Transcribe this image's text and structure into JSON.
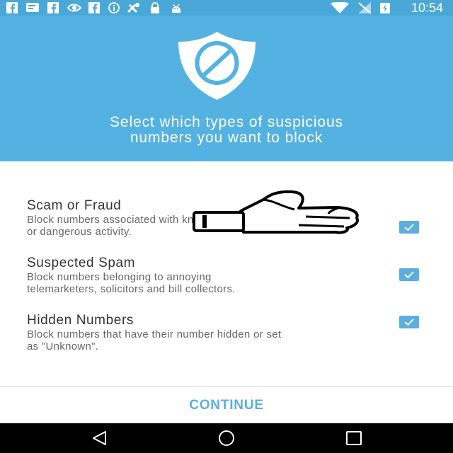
{
  "status_bar": {
    "time": "10:54",
    "icons": [
      "facebook-icon",
      "message-icon",
      "facebook-icon",
      "nvidia-icon",
      "facebook-icon",
      "info-icon",
      "tools-icon",
      "lock-icon",
      "android-icon",
      "wifi-icon",
      "no-signal-icon",
      "battery-charging-icon"
    ]
  },
  "header": {
    "icon": "shield-block-icon",
    "title_line1": "Select which types of suspicious",
    "title_line2": "numbers you want to block"
  },
  "options": [
    {
      "title": "Scam or Fraud",
      "desc_line1": "Block numbers associated with known scams, fraud",
      "desc_line2": "or dangerous activity.",
      "checked": true
    },
    {
      "title": "Suspected Spam",
      "desc_line1": "Block numbers belonging to annoying",
      "desc_line2": "telemarketers, solicitors and bill collectors.",
      "checked": true
    },
    {
      "title": "Hidden Numbers",
      "desc_line1": "Block numbers that have their number hidden or set",
      "desc_line2": "as \"Unknown\".",
      "checked": true
    }
  ],
  "overlay": {
    "icon": "thumbs-up-icon"
  },
  "footer": {
    "continue_label": "CONTINUE"
  },
  "nav_bar": {
    "icons": [
      "back-icon",
      "home-icon",
      "recents-icon"
    ]
  },
  "colors": {
    "header": "#54b2e2",
    "status_bar": "#4aa8d8",
    "accent": "#5aaee0",
    "nav_bar": "#000000"
  }
}
